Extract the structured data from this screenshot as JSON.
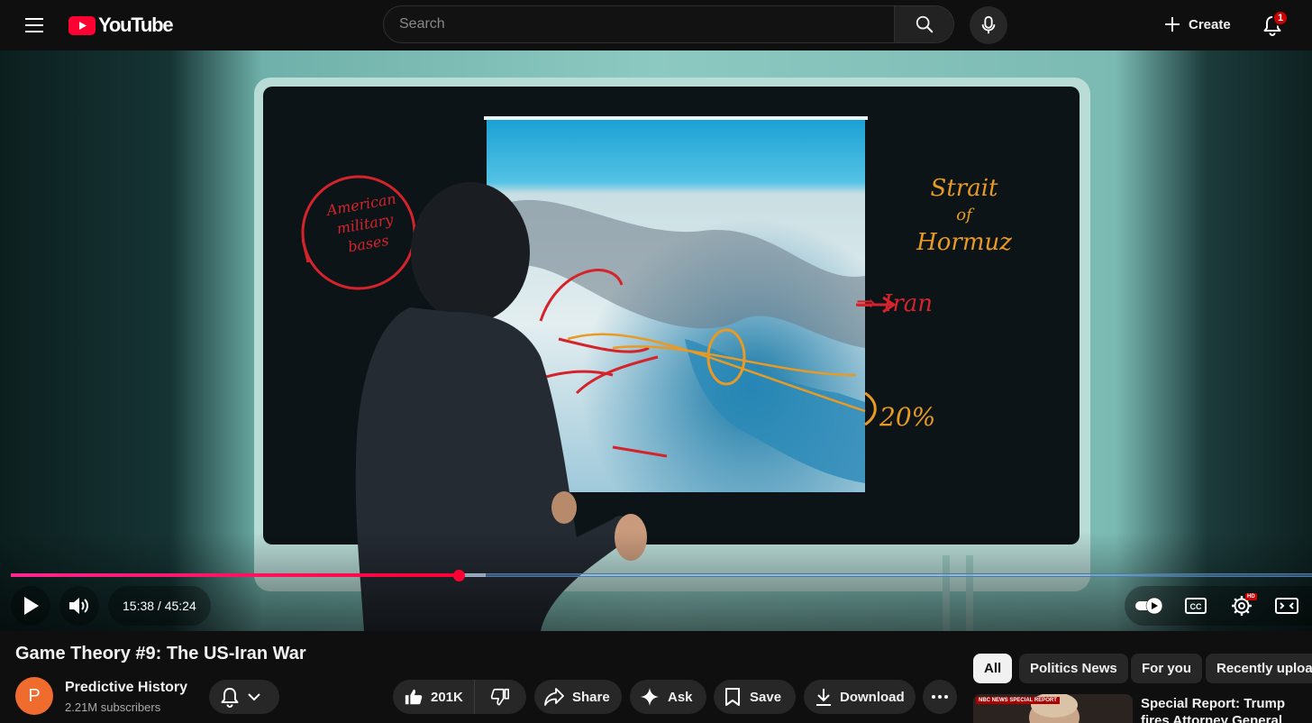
{
  "header": {
    "logo_text": "YouTube",
    "search_placeholder": "Search",
    "create_label": "Create",
    "notification_count": "1"
  },
  "video_overlay": {
    "whiteboard_left": [
      "American",
      "military",
      "bases"
    ],
    "whiteboard_right_title": [
      "Strait",
      "of",
      "Hormuz"
    ],
    "whiteboard_arrow_label": "⇒ Iran",
    "whiteboard_percent": "20%"
  },
  "player": {
    "current_time": "15:38",
    "duration": "45:24",
    "time_display": "15:38 / 45:24",
    "progress_fraction": 0.3443,
    "buffered_fraction": 0.365,
    "colors": {
      "played": "#ff0033",
      "played_start": "#ff2791"
    }
  },
  "video": {
    "title": "Game Theory #9: The US-Iran War",
    "channel_initial": "P",
    "channel_name": "Predictive History",
    "subscribers": "2.21M subscribers",
    "avatar_color": "#ef6c2e"
  },
  "actions": {
    "like_count": "201K",
    "share": "Share",
    "ask": "Ask",
    "save": "Save",
    "download": "Download"
  },
  "chips": [
    {
      "label": "All",
      "active": true
    },
    {
      "label": "Politics News",
      "active": false
    },
    {
      "label": "For you",
      "active": false
    },
    {
      "label": "Recently uploaded",
      "active": false
    }
  ],
  "recommendations": [
    {
      "thumb_label": "NBC NEWS SPECIAL REPORT",
      "title": "Special Report: Trump fires Attorney General Pam Bondi"
    }
  ]
}
